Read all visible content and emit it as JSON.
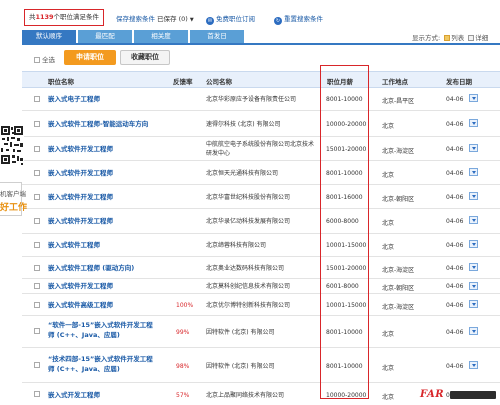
{
  "topbar": {
    "count_prefix": "共",
    "count_value": "1139",
    "count_suffix": "个职位满足条件",
    "save_search": "保存搜索条件",
    "saved": "已保存 (0)",
    "saved_caret": "▼",
    "subscribe": "免费职位订阅",
    "reset": "重置搜索条件"
  },
  "tabs": [
    "默认顺序",
    "最匹配",
    "相关度",
    "首发日"
  ],
  "display_mode": {
    "label": "显示方式:",
    "list": "列表",
    "detail": "详细"
  },
  "actions": {
    "select_all": "全选",
    "apply": "申请职位",
    "favorite": "收藏职位"
  },
  "columns": {
    "title": "职位名称",
    "feedback": "反馈率",
    "company": "公司名称",
    "salary": "职位月薪",
    "location": "工作地点",
    "date": "发布日期"
  },
  "rows": [
    {
      "title": "嵌入式电子工程师",
      "feedback": "",
      "company": "北京华彩原应予设备有限责任公司",
      "salary": "8001-10000",
      "location": "北京-昌平区",
      "date": "04-06"
    },
    {
      "title": "嵌入式软件工程师-智能运动车方向",
      "feedback": "",
      "company": "速得尔科技 (北京) 有限公司",
      "salary": "10000-20000",
      "location": "北京",
      "date": "04-06"
    },
    {
      "title": "嵌入式软件开发工程师",
      "feedback": "",
      "company": "中航航空电子系统股份有限公司北京技术\n研发中心",
      "salary": "15001-20000",
      "location": "北京-海淀区",
      "date": "04-06"
    },
    {
      "title": "嵌入式软件开发工程师",
      "feedback": "",
      "company": "北京恒天光通科技有限公司",
      "salary": "8001-10000",
      "location": "北京",
      "date": "04-06"
    },
    {
      "title": "嵌入式软件开发工程师",
      "feedback": "",
      "company": "北京华富世纪科技股份有限公司",
      "salary": "8001-16000",
      "location": "北京-朝阳区",
      "date": "04-06"
    },
    {
      "title": "嵌入式软件开发工程师",
      "feedback": "",
      "company": "北京华录亿动科技发展有限公司",
      "salary": "6000-8000",
      "location": "北京",
      "date": "04-06"
    },
    {
      "title": "嵌入式软件工程师",
      "feedback": "",
      "company": "北京缔蓉科技有限公司",
      "salary": "10001-15000",
      "location": "北京",
      "date": "04-06"
    },
    {
      "title": "嵌入式软件工程师 (驱动方向)",
      "feedback": "",
      "company": "北京奥业达数码科技有限公司",
      "salary": "15001-20000",
      "location": "北京-海淀区",
      "date": "04-06"
    },
    {
      "title": "嵌入式软件开发工程师",
      "feedback": "",
      "company": "北京莫科创纪信息技术有限公司",
      "salary": "6001-8000",
      "location": "北京-朝阳区",
      "date": "04-06"
    },
    {
      "title": "嵌入式软件高级工程师",
      "feedback": "100%",
      "company": "北京优尔博特创新科技有限公司",
      "salary": "10001-15000",
      "location": "北京-海淀区",
      "date": "04-06"
    },
    {
      "title": "“软件一部-15”嵌入式软件开发工程\n师 (C++、Java、应届)",
      "feedback": "99%",
      "company": "因特软件 (北京) 有限公司",
      "salary": "8001-10000",
      "location": "北京",
      "date": "04-06"
    },
    {
      "title": "“技术四部-15”嵌入式软件开发工程\n师 (C++、Java、应届)",
      "feedback": "98%",
      "company": "因特软件 (北京) 有限公司",
      "salary": "8001-10000",
      "location": "北京",
      "date": "04-06"
    },
    {
      "title": "嵌入式开发工程师",
      "feedback": "57%",
      "company": "北京上品聚同络技术有限公司",
      "salary": "10000-20000",
      "location": "北京",
      "date": "04-06"
    }
  ],
  "sidebar": {
    "text1": "机客户端",
    "text2": "好工作"
  },
  "watermark": "FAR",
  "colors": {
    "accent_blue": "#3578c2",
    "link_blue": "#1a5aa6",
    "highlight_red": "#d8262a",
    "apply_orange": "#f39a1f"
  }
}
